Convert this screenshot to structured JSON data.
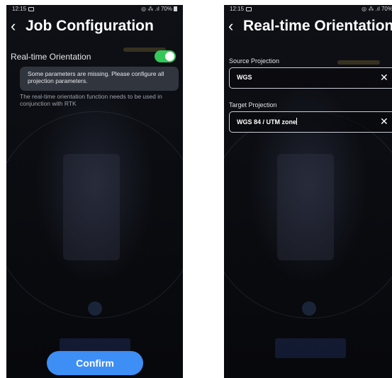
{
  "left_screen": {
    "status": {
      "time": "12:15",
      "indicators": "◎ ⁂ .ıl 70%"
    },
    "header": {
      "title": "Job Configuration"
    },
    "realtime_orientation": {
      "label": "Real-time Orientation",
      "enabled": true
    },
    "warning": "Some parameters are missing. Please configure all projection parameters.",
    "note": "The real-time orientation function needs to be used in conjunction with RTK",
    "confirm_label": "Confirm"
  },
  "right_screen": {
    "status": {
      "time": "12:15",
      "indicators": "◎ ⁂ .ıl 70%"
    },
    "header": {
      "title": "Real-time Orientation"
    },
    "source_projection": {
      "label": "Source Projection",
      "value": "WGS"
    },
    "target_projection": {
      "label": "Target Projection",
      "value": "WGS 84 / UTM zone"
    }
  },
  "icons": {
    "back": "chevron-left-icon",
    "clear": "close-icon"
  },
  "colors": {
    "toggle_on": "#34c759",
    "confirm_button": "#3d8ef5",
    "background": "#0b0d12"
  }
}
